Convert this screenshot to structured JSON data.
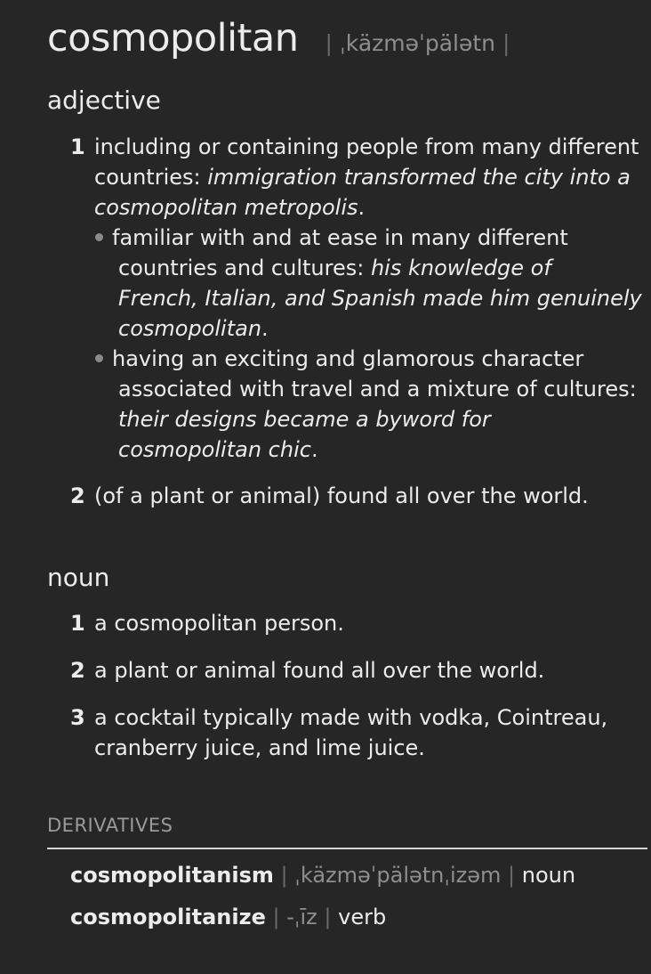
{
  "entry": {
    "headword": "cosmopolitan",
    "pronunciation": "ˌkäzməˈpälətn",
    "pron_bar": "|"
  },
  "adjective": {
    "label": "adjective",
    "sense1": {
      "num": "1",
      "line1": "including or containing people from many different",
      "line2_plain": "countries: ",
      "line2_ex": "immigration transformed the city into a",
      "line3_ex": "cosmopolitan metropolis",
      "line3_end": "."
    },
    "sub1": {
      "line1": "familiar with and at ease in many different",
      "line2_plain": "countries and cultures: ",
      "line2_ex": "his knowledge of",
      "line3_ex": "French, Italian, and Spanish made him genuinely",
      "line4_ex": "cosmopolitan",
      "line4_end": "."
    },
    "sub2": {
      "line1": "having an exciting and glamorous character",
      "line2": "associated with travel and a mixture of cultures:",
      "line3_ex": "their designs became a byword for",
      "line4_ex": "cosmopolitan chic",
      "line4_end": "."
    },
    "sense2": {
      "num": "2",
      "text": "(of a plant or animal) found all over the world."
    }
  },
  "noun": {
    "label": "noun",
    "sense1": {
      "num": "1",
      "text": "a cosmopolitan person."
    },
    "sense2": {
      "num": "2",
      "text": "a plant or animal found all over the world."
    },
    "sense3": {
      "num": "3",
      "line1": "a cocktail typically made with vodka, Cointreau,",
      "line2": "cranberry juice, and lime juice."
    }
  },
  "derivatives": {
    "heading": "DERIVATIVES",
    "sep": "|",
    "items": [
      {
        "word": "cosmopolitanism",
        "pron": "ˌkäzməˈpälətnˌizəm",
        "pos": "noun"
      },
      {
        "word": "cosmopolitanize",
        "pron": "-ˌīz",
        "pos": "verb"
      }
    ]
  }
}
